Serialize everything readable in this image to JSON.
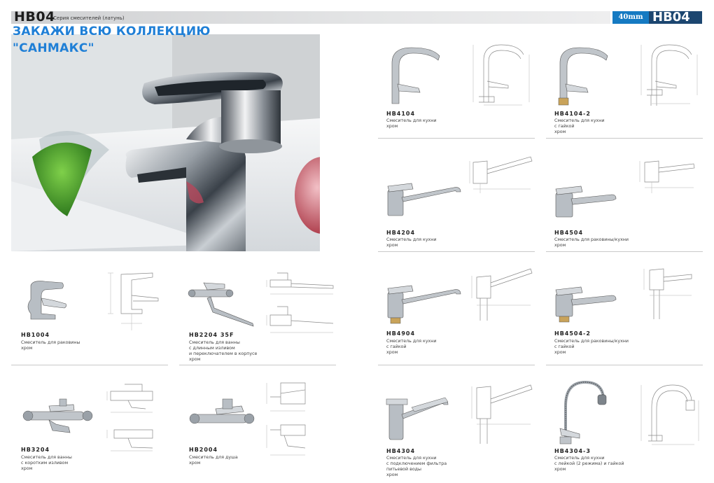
{
  "header": {
    "series_code": "HB04",
    "series_title": "Серия смесителей (латунь)",
    "size_badge": "40mm",
    "series_code_right": "HB04"
  },
  "promo": {
    "line1": "ЗАКАЖИ ВСЮ КОЛЛЕКЦИЮ",
    "line2": "\"САНМАКС\""
  },
  "products": [
    {
      "code": "HB1004",
      "desc": "Смеситель для раковины\nхром"
    },
    {
      "code": "HB2204   35F",
      "desc": "Смеситель для ванны\nс длинным изливом\nи переключателем в корпусе\nхром"
    },
    {
      "code": "HB3204",
      "desc": "Смеситель для ванны\nс коротким изливом\nхром"
    },
    {
      "code": "HB2004",
      "desc": "Смеситель для душа\nхром"
    },
    {
      "code": "HB4104",
      "desc": "Смеситель для кухни\nхром"
    },
    {
      "code": "HB4104-2",
      "desc": "Смеситель для кухни\nс гайкой\nхром"
    },
    {
      "code": "HB4204",
      "desc": "Смеситель для кухни\nхром"
    },
    {
      "code": "HB4504",
      "desc": "Смеситель для раковины/кухни\nхром"
    },
    {
      "code": "HB4904",
      "desc": "Смеситель для кухни\nс гайкой\nхром"
    },
    {
      "code": "HB4504-2",
      "desc": "Смеситель для раковины/кухни\nс гайкой\nхром"
    },
    {
      "code": "HB4304",
      "desc": "Смеситель для кухни\nс подключением фильтра\nпитьевой воды\nхром"
    },
    {
      "code": "HB4304-3",
      "desc": "Смеситель для кухни\nс лейкой (2 режима) и гайкой\nхром"
    }
  ],
  "colors": {
    "promo_blue": "#1f7fd6",
    "badge_blue": "#157ac2",
    "badge_navy": "#1c4670",
    "header_gray": "#d7d8da"
  }
}
